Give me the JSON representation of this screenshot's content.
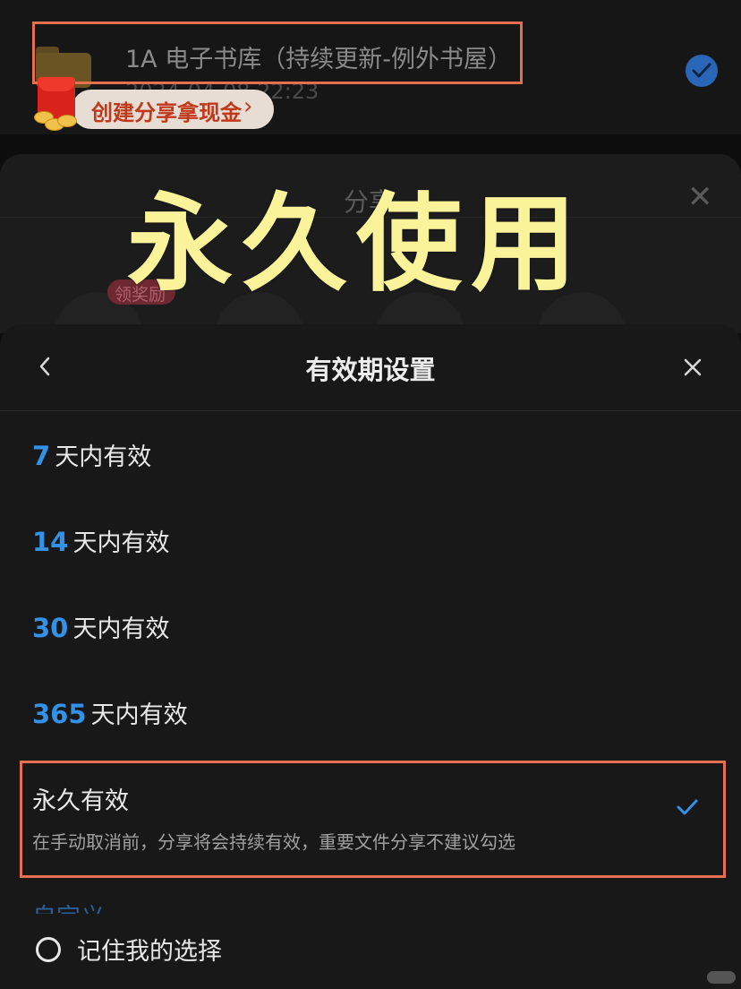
{
  "file": {
    "name": "1A 电子书库（持续更新-例外书屋）",
    "date": "2024-04-08 22:23"
  },
  "promo": {
    "label": "创建分享拿现金",
    "chevron": "›"
  },
  "share_sheet": {
    "title": "分享",
    "reward_badge": "领奖励"
  },
  "overlay_caption": "永久使用",
  "panel": {
    "title": "有效期设置",
    "options": [
      {
        "num": "7",
        "text": "天内有效"
      },
      {
        "num": "14",
        "text": "天内有效"
      },
      {
        "num": "30",
        "text": "天内有效"
      },
      {
        "num": "365",
        "text": "天内有效"
      }
    ],
    "permanent": {
      "title": "永久有效",
      "description": "在手动取消前，分享将会持续有效，重要文件分享不建议勾选",
      "selected": true
    },
    "peek_text": "自定义",
    "remember_label": "记住我的选择"
  },
  "colors": {
    "accent": "#3391e8",
    "highlight": "#e5704f",
    "overlay_text": "#fbf39a"
  }
}
